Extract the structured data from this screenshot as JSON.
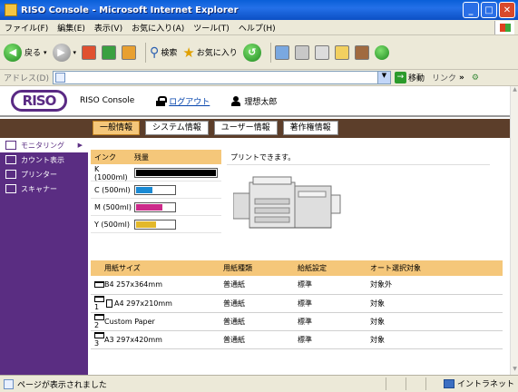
{
  "window": {
    "title": "RISO Console - Microsoft Internet Explorer"
  },
  "menu": [
    "ファイル(F)",
    "編集(E)",
    "表示(V)",
    "お気に入り(A)",
    "ツール(T)",
    "ヘルプ(H)"
  ],
  "toolbar": {
    "back_label": "戻る",
    "search_label": "検索",
    "favorites_label": "お気に入り"
  },
  "address": {
    "label": "アドレス(D)",
    "go_label": "移動",
    "links_label": "リンク"
  },
  "header": {
    "logo": "RISO",
    "console_label": "RISO Console",
    "logout_label": "ログアウト",
    "user_name": "理想太郎"
  },
  "tabs": [
    {
      "label": "一般情報",
      "active": true
    },
    {
      "label": "システム情報",
      "active": false
    },
    {
      "label": "ユーザー情報",
      "active": false
    },
    {
      "label": "著作権情報",
      "active": false
    }
  ],
  "sidebar": [
    {
      "label": "モニタリング",
      "icon": "monitor-icon",
      "active": true
    },
    {
      "label": "カウント表示",
      "icon": "counter-icon",
      "active": false
    },
    {
      "label": "プリンター",
      "icon": "printer-icon",
      "active": false
    },
    {
      "label": "スキャナー",
      "icon": "scanner-icon",
      "active": false
    }
  ],
  "ink": {
    "header_ink": "インク",
    "header_level": "残量",
    "rows": [
      {
        "label": "K (1000ml)",
        "level": 1.0,
        "color": "#000000"
      },
      {
        "label": "C (500ml)",
        "level": 0.45,
        "color": "#1a8ad4"
      },
      {
        "label": "M (500ml)",
        "level": 0.7,
        "color": "#cc2a8a"
      },
      {
        "label": "Y (500ml)",
        "level": 0.55,
        "color": "#e3b82a"
      }
    ]
  },
  "status": {
    "message": "プリントできます。"
  },
  "paper_table": {
    "headers": [
      "用紙サイズ",
      "用紙種類",
      "給紙設定",
      "オート選択対象"
    ],
    "rows": [
      {
        "tray": "",
        "size": "B4 257x364mm",
        "type": "普通紙",
        "feed": "標準",
        "auto": "対象外"
      },
      {
        "tray": "1",
        "size": "A4 297x210mm",
        "type": "普通紙",
        "feed": "標準",
        "auto": "対象"
      },
      {
        "tray": "2",
        "size": "Custom Paper",
        "type": "普通紙",
        "feed": "標準",
        "auto": "対象"
      },
      {
        "tray": "3",
        "size": "A3 297x420mm",
        "type": "普通紙",
        "feed": "標準",
        "auto": "対象"
      }
    ]
  },
  "statusbar": {
    "message": "ページが表示されました",
    "zone": "イントラネット"
  }
}
